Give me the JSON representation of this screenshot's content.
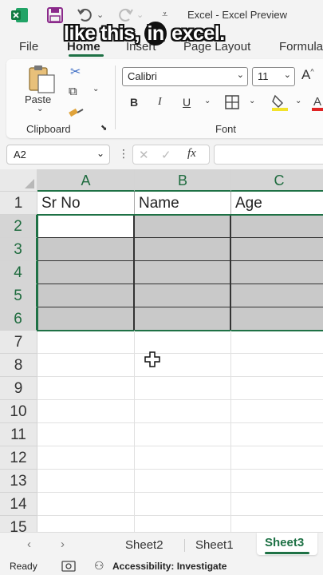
{
  "titlebar": {
    "title": "Excel  -  Excel Preview"
  },
  "caption": {
    "before": "like this, ",
    "highlight": "in",
    "after": " excel."
  },
  "ribbon_tabs": [
    {
      "label": "File"
    },
    {
      "label": "Home"
    },
    {
      "label": "Insert"
    },
    {
      "label": "Page Layout"
    },
    {
      "label": "Formulas"
    }
  ],
  "ribbon": {
    "clipboard": {
      "label": "Clipboard",
      "paste_label": "Paste"
    },
    "font": {
      "label": "Font",
      "font_name": "Calibri",
      "font_size": "11"
    }
  },
  "formula_bar": {
    "name_box": "A2",
    "fx": "fx"
  },
  "grid": {
    "columns": [
      "A",
      "B",
      "C"
    ],
    "rows": [
      "1",
      "2",
      "3",
      "4",
      "5",
      "6",
      "7",
      "8",
      "9",
      "10",
      "11",
      "12",
      "13",
      "14",
      "15"
    ],
    "row1": [
      "Sr No",
      "Name",
      "Age"
    ]
  },
  "sheets": [
    {
      "label": "Sheet2"
    },
    {
      "label": "Sheet1"
    },
    {
      "label": "Sheet3"
    }
  ],
  "status": {
    "ready": "Ready",
    "accessibility": "Accessibility: Investigate"
  },
  "colors": {
    "accent": "#1e7145",
    "selection": "#c9c9c9"
  }
}
